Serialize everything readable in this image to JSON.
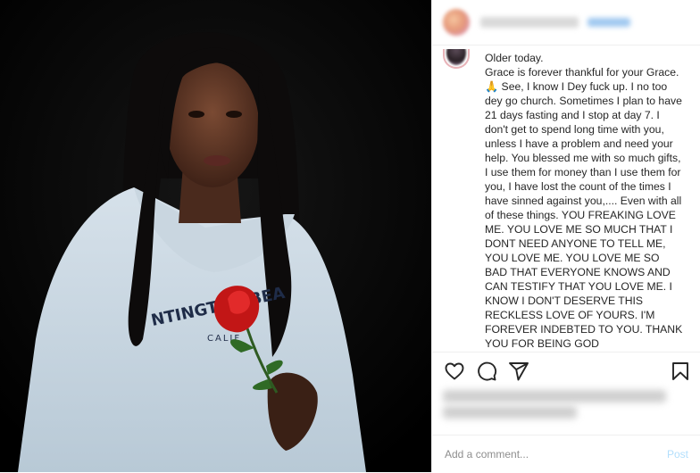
{
  "caption": {
    "text": "Older today.\nGrace is forever thankful for your Grace.🙏 See, I know I Dey fuck up. I no too dey go church. Sometimes I plan to have 21 days fasting and I stop at day 7. I don't get to spend long time with you, unless I have a problem and need your help. You blessed me with so much gifts, I use them for money than I use them for you, I have lost the count of the times I have sinned against you,.... Even with all of these things. YOU FREAKING LOVE ME. YOU LOVE ME SO MUCH THAT I DONT NEED ANYONE TO TELL ME, YOU LOVE ME. YOU LOVE ME SO BAD THAT EVERYONE KNOWS AND CAN TESTIFY THAT YOU LOVE ME. I KNOW I DON'T DESERVE THIS RECKLESS LOVE OF YOURS. I'M FOREVER INDEBTED TO YOU. THANK YOU FOR BEING GOD"
  },
  "photo": {
    "hoodie_text_1": "NTINGTON BEA",
    "hoodie_text_2": "CALIF"
  },
  "actions": {
    "icons": [
      "heart-icon",
      "comment-icon",
      "share-icon",
      "bookmark-icon"
    ]
  },
  "comment": {
    "placeholder": "Add a comment...",
    "post_label": "Post"
  },
  "colors": {
    "background": "#ffffff",
    "text": "#262626",
    "muted": "#8e8e8e",
    "post_disabled": "#b2dffc",
    "divider": "#efefef"
  }
}
